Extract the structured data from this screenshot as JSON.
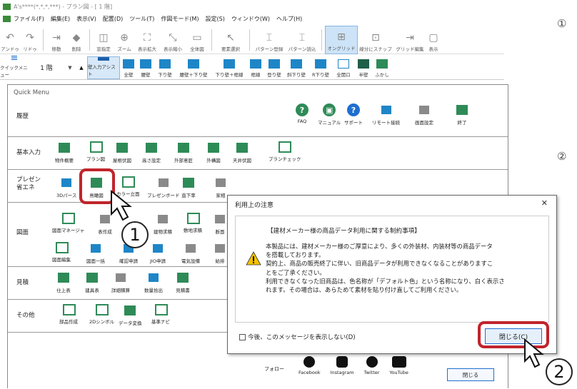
{
  "window": {
    "title": "A's****(*,*,*,***) - プラン図 - [ 1 階]"
  },
  "menu": [
    "ファイル(F)",
    "編集(E)",
    "表示(V)",
    "配置(D)",
    "ツール(T)",
    "作図モード(M)",
    "設定(S)",
    "ウィンドウ(W)",
    "ヘルプ(H)"
  ],
  "toolbar1": [
    {
      "glyph": "↶",
      "label": "アンドゥ"
    },
    {
      "glyph": "↷",
      "label": "リドゥ"
    },
    {
      "glyph": "⇥",
      "label": "移動"
    },
    {
      "glyph": "◆",
      "label": "削除"
    },
    {
      "glyph": "◫",
      "label": "窓指定"
    },
    {
      "glyph": "⊕",
      "label": "ズーム"
    },
    {
      "glyph": "⛶",
      "label": "表示拡大"
    },
    {
      "glyph": "⤡",
      "label": "表示縮小"
    },
    {
      "glyph": "▭",
      "label": "全体図"
    },
    {
      "glyph": "↖",
      "label": "要素選択"
    },
    {
      "glyph": "⌶",
      "label": "パターン登録"
    },
    {
      "glyph": "⌶",
      "label": "パターン読込"
    },
    {
      "glyph": "⊞",
      "label": "オングリッド"
    },
    {
      "glyph": "⊡",
      "label": "線分にスナップ"
    },
    {
      "glyph": "⇥",
      "label": "グリッド編集"
    },
    {
      "glyph": "▢",
      "label": "表示"
    }
  ],
  "toolbar2": {
    "quickmenu_label": "クイックメニュー",
    "floor": "1 階",
    "wall_input": "壁入力アシスト",
    "walls": [
      "全壁",
      "腰壁",
      "下り壁",
      "腰壁＋下り壁",
      "下り壁＋框線",
      "框線",
      "登り壁",
      "斜下り壁",
      "R下り壁",
      "全開口",
      "半壁",
      "ふかし"
    ]
  },
  "quickmenu": {
    "title": "Quick Menu",
    "rows": [
      {
        "label": "履歴",
        "items": [
          {
            "label": "FAQ",
            "color": "#2e8b57"
          },
          {
            "label": "マニュアル",
            "color": "#2e8b57"
          },
          {
            "label": "サポート",
            "color": "#1e6fd0"
          },
          {
            "label": "リモート接続",
            "color": "#1e86c7"
          },
          {
            "label": "画面設定",
            "color": "#8a8a8a"
          },
          {
            "label": "終了",
            "color": "#2e8b57"
          }
        ]
      },
      {
        "label": "基本入力",
        "items": [
          "物件概要",
          "プラン図",
          "屋根伏図",
          "高さ設定",
          "外部意匠",
          "外構図",
          "天井伏図",
          "プランチェック"
        ]
      },
      {
        "label": "プレゼン\n省エネ",
        "items": [
          "3Dパース",
          "鳥瞰図",
          "カラー立面",
          "プレゼンボード",
          "直下率",
          "家相"
        ]
      },
      {
        "label": "図面",
        "items_row1": [
          "図面マネージャ",
          "表作成",
          "",
          "建物求積",
          "敷地求積",
          "断面"
        ],
        "items_row2": [
          "図面編集",
          "図面一括",
          "確認申請",
          "JIO申請",
          "電気設備",
          "給排"
        ]
      },
      {
        "label": "見積",
        "items": [
          "仕上表",
          "建具表",
          "詳細積算",
          "数量拾出",
          "見積書"
        ]
      },
      {
        "label": "その他",
        "items": [
          "部品作成",
          "2Dシンボル",
          "データ変換",
          "基準ナビ"
        ]
      }
    ],
    "follow_label": "フォロー",
    "sns": [
      "Facebook",
      "Instagram",
      "Twitter",
      "YouTube"
    ],
    "close_label": "閉じる"
  },
  "dialog": {
    "title": "利用上の注意",
    "heading": "【建材メーカー様の商品データ利用に関する制約事項】",
    "body": [
      "本製品には、建材メーカー様のご厚意により、多くの外装材、内装材等の商品データ",
      "を搭載しております。",
      "契約上、商品の販売終了に伴い、旧商品データが利用できなくなることがありますこ",
      "とをご了承ください。",
      "利用できなくなった旧商品は、色名称が「デフォルト色」という名称になり、白く表示さ",
      "れます。その場合は、あらためて素材を貼り付け直してご利用ください。"
    ],
    "checkbox_label": "今後、このメッセージを表示しない(D)",
    "close_button": "閉じる(C)"
  },
  "annotations": {
    "step1": "1",
    "step2": "2"
  },
  "side_markers": [
    "①",
    "②"
  ],
  "colors": {
    "highlight": "#c0242c",
    "accent": "#1e6fd0",
    "green": "#2e8b57"
  }
}
